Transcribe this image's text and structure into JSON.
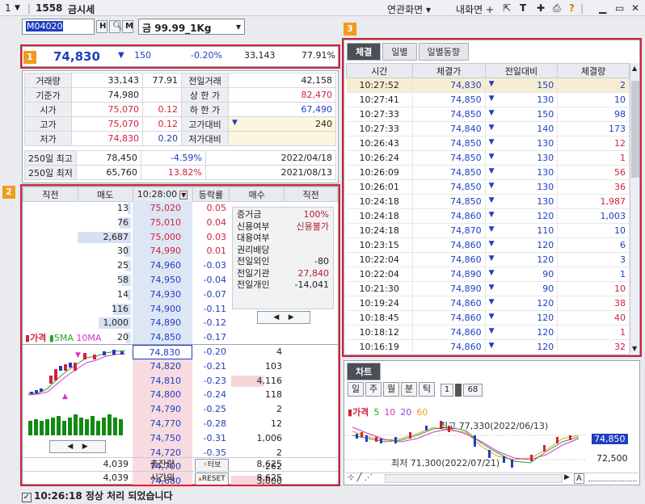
{
  "window": {
    "menu_num": "1",
    "code": "1558",
    "title": "금시세",
    "related": "연관화면",
    "myscreen": "내화면"
  },
  "toolbar": {
    "code": "M04020",
    "btn_h": "H",
    "btn_q": "Q",
    "btn_m": "M",
    "product": "금 99.99_1Kg"
  },
  "badges": {
    "b1": "1",
    "b2": "2",
    "b3": "3"
  },
  "price": {
    "current": "74,830",
    "arrow": "▼",
    "change": "150",
    "rate": "-0.20%",
    "volume": "33,143",
    "ratio": "77.91%"
  },
  "quote": {
    "rows": [
      {
        "l1": "거래량",
        "v1": "33,143",
        "v1b": "77.91",
        "l2": "전일거래",
        "v2": "42,158"
      },
      {
        "l1": "기준가",
        "v1": "74,980",
        "v1b": "",
        "l2": "상 한 가",
        "v2": "82,470"
      },
      {
        "l1": "시가",
        "v1": "75,070",
        "v1b": "0.12",
        "l2": "하 한 가",
        "v2": "67,490"
      },
      {
        "l1": "고가",
        "v1": "75,070",
        "v1b": "0.12",
        "l2": "고가대비",
        "v2": "240"
      },
      {
        "l1": "저가",
        "v1": "74,830",
        "v1b": "0.20",
        "l2": "저가대비",
        "v2": ""
      }
    ],
    "w250": [
      {
        "l": "250일 최고",
        "v": "78,450",
        "r": "-4.59%",
        "d": "2022/04/18"
      },
      {
        "l": "250일 최저",
        "v": "65,760",
        "r": "13.82%",
        "d": "2021/08/13"
      }
    ]
  },
  "orderbook": {
    "headers": [
      "직전",
      "매도",
      "10:28:00",
      "등락률",
      "매수",
      "직전"
    ],
    "asks": [
      {
        "v": "13",
        "p": "75,020",
        "r": "0.05"
      },
      {
        "v": "76",
        "p": "75,010",
        "r": "0.04"
      },
      {
        "v": "2,687",
        "p": "75,000",
        "r": "0.03"
      },
      {
        "v": "30",
        "p": "74,990",
        "r": "0.01"
      },
      {
        "v": "25",
        "p": "74,960",
        "r": "-0.03"
      },
      {
        "v": "58",
        "p": "74,950",
        "r": "-0.04"
      },
      {
        "v": "14",
        "p": "74,930",
        "r": "-0.07"
      },
      {
        "v": "116",
        "p": "74,900",
        "r": "-0.11"
      },
      {
        "v": "1,000",
        "p": "74,890",
        "r": "-0.12"
      },
      {
        "v": "20",
        "p": "74,850",
        "r": "-0.17"
      }
    ],
    "bids": [
      {
        "p": "74,830",
        "r": "-0.20",
        "v": "4"
      },
      {
        "p": "74,820",
        "r": "-0.21",
        "v": "103"
      },
      {
        "p": "74,810",
        "r": "-0.23",
        "v": "4,116"
      },
      {
        "p": "74,800",
        "r": "-0.24",
        "v": "118"
      },
      {
        "p": "74,790",
        "r": "-0.25",
        "v": "2"
      },
      {
        "p": "74,770",
        "r": "-0.28",
        "v": "12"
      },
      {
        "p": "74,750",
        "r": "-0.31",
        "v": "1,006"
      },
      {
        "p": "74,720",
        "r": "-0.35",
        "v": "2"
      },
      {
        "p": "74,700",
        "r": "-0.37",
        "v": "262"
      },
      {
        "p": "74,680",
        "r": "-0.40",
        "v": "3,000"
      }
    ],
    "info": [
      {
        "l": "증거금",
        "v": "100%"
      },
      {
        "l": "신용여부",
        "v": "신용불가"
      },
      {
        "l": "대용여부",
        "v": ""
      },
      {
        "l": "권리배당",
        "v": ""
      },
      {
        "l": "전일외인",
        "v": "-80"
      },
      {
        "l": "전일기관",
        "v": "27,840"
      },
      {
        "l": "전일개인",
        "v": "-14,041"
      }
    ],
    "mini_legend": {
      "price": "가격",
      "ma5": "5MA",
      "ma10": "10MA"
    },
    "footer": [
      {
        "v1": "4,039",
        "l": "총잔량",
        "btn": "",
        "v2": "8,625"
      },
      {
        "v1": "4,039",
        "l": "시간외",
        "btn": "",
        "v2": "8,625"
      }
    ],
    "btn_turbo": "터보",
    "btn_reset": "RESET"
  },
  "ticks": {
    "tabs": [
      "체결",
      "일별",
      "일별동향"
    ],
    "headers": [
      "시간",
      "체결가",
      "전일대비",
      "체결량"
    ],
    "rows": [
      [
        "10:27:52",
        "74,830",
        "150",
        "2"
      ],
      [
        "10:27:41",
        "74,850",
        "130",
        "10"
      ],
      [
        "10:27:33",
        "74,850",
        "150",
        "98"
      ],
      [
        "10:27:33",
        "74,840",
        "140",
        "173"
      ],
      [
        "10:26:43",
        "74,850",
        "130",
        "12"
      ],
      [
        "10:26:24",
        "74,850",
        "130",
        "1"
      ],
      [
        "10:26:09",
        "74,850",
        "130",
        "56"
      ],
      [
        "10:26:01",
        "74,850",
        "130",
        "36"
      ],
      [
        "10:24:18",
        "74,850",
        "130",
        "1,987"
      ],
      [
        "10:24:18",
        "74,860",
        "120",
        "1,003"
      ],
      [
        "10:24:18",
        "74,870",
        "110",
        "10"
      ],
      [
        "10:23:15",
        "74,860",
        "120",
        "6"
      ],
      [
        "10:22:04",
        "74,860",
        "120",
        "3"
      ],
      [
        "10:22:04",
        "74,890",
        "90",
        "1"
      ],
      [
        "10:21:30",
        "74,890",
        "90",
        "10"
      ],
      [
        "10:19:24",
        "74,860",
        "120",
        "38"
      ],
      [
        "10:18:45",
        "74,860",
        "120",
        "40"
      ],
      [
        "10:18:12",
        "74,860",
        "120",
        "1"
      ],
      [
        "10:16:19",
        "74,860",
        "120",
        "32"
      ]
    ],
    "colors": [
      "dn",
      "dn",
      "dn",
      "dn",
      "up",
      "up",
      "up",
      "up",
      "up",
      "dn",
      "dn",
      "dn",
      "dn",
      "dn",
      "up",
      "up",
      "up",
      "up",
      "up"
    ]
  },
  "chart": {
    "tab": "차트",
    "periods": [
      "일",
      "주",
      "월",
      "분",
      "틱"
    ],
    "count1": "1",
    "count2": "68",
    "legend": [
      "가격",
      "5",
      "10",
      "20",
      "60"
    ],
    "high_label": "최고 77,330(2022/06/13)",
    "low_label": "최저 71,300(2022/07/21)",
    "price_tag": "74,850",
    "axis_label": "72,500",
    "bottom_a": "A"
  },
  "status": {
    "text": "10:26:18 정상 처리 되었습니다"
  }
}
